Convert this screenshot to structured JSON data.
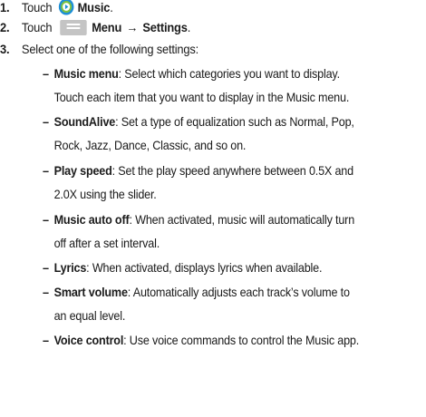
{
  "steps": [
    {
      "number": "1.",
      "prefix": "Touch",
      "icon": "music-app-icon",
      "label": "Music",
      "suffix": "."
    },
    {
      "number": "2.",
      "prefix": "Touch",
      "icon": "menu-key-icon",
      "label": "Menu",
      "arrow": "→",
      "target": "Settings",
      "suffix": "."
    },
    {
      "number": "3.",
      "text": "Select one of the following settings:"
    }
  ],
  "settings": [
    {
      "name": "Music menu",
      "line1": ": Select which categories you want to display.",
      "line2": "Touch each item that you want to display in the Music menu."
    },
    {
      "name": "SoundAlive",
      "line1": ": Set a type of equalization such as Normal, Pop,",
      "line2": "Rock, Jazz, Dance, Classic, and so on."
    },
    {
      "name": "Play speed",
      "line1": ": Set the play speed anywhere between 0.5X and",
      "line2": "2.0X using the slider."
    },
    {
      "name": "Music auto off",
      "line1": ": When activated, music will automatically turn",
      "line2": "off after a set interval."
    },
    {
      "name": "Lyrics",
      "line1": ": When activated, displays lyrics when available."
    },
    {
      "name": "Smart volume",
      "line1": ": Automatically adjusts each track’s volume to",
      "line2": "an equal level."
    },
    {
      "name": "Voice control",
      "line1": ": Use voice commands to control the Music app."
    }
  ],
  "dash": "–",
  "colors": {
    "music_icon_outer": "#1d8fd6",
    "music_icon_inner": "#7ec242",
    "menu_icon_bg": "#c4c4c4"
  }
}
